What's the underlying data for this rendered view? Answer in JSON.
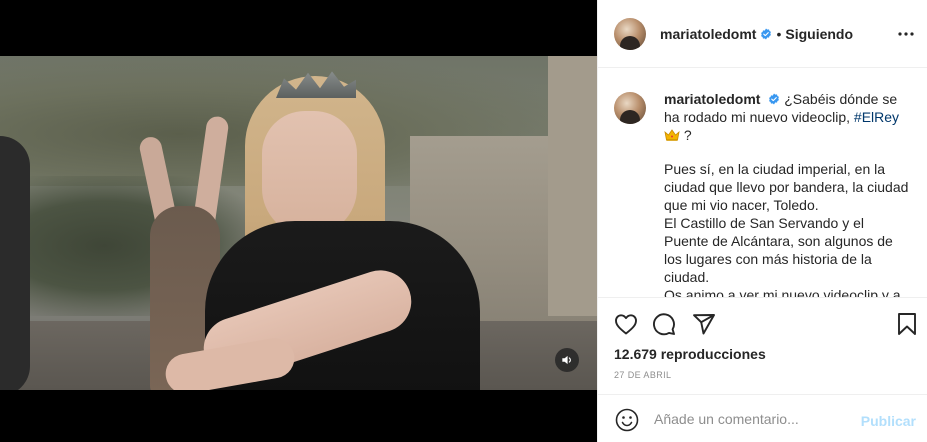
{
  "video": {
    "sound_icon": "speaker-icon"
  },
  "header": {
    "username": "mariatoledomt",
    "separator": "•",
    "follow_status": "Siguiendo",
    "more_icon": "more-options-icon",
    "verified_color": "#3897f0"
  },
  "caption": {
    "username": "mariatoledomt",
    "line1": "¿Sabéis dónde se ha rodado mi nuevo videoclip, ",
    "hashtag": "#ElRey",
    "emoji": "crown-emoji",
    "after_emoji": "?",
    "paragraph": [
      "Pues sí, en la ciudad imperial, en la ciudad que llevo por bandera, la ciudad que mi vio nacer, Toledo.",
      "El Castillo de San Servando y el Puente de Alcántara, son algunos de los lugares con más historia de la ciudad.",
      "Os animo a ver mi nuevo videoclip y a"
    ]
  },
  "actions": {
    "like_icon": "heart-icon",
    "comment_icon": "comment-icon",
    "share_icon": "share-icon",
    "save_icon": "bookmark-icon"
  },
  "stats": {
    "views": "12.679 reproducciones",
    "date": "27 DE ABRIL"
  },
  "comment_box": {
    "placeholder": "Añade un comentario...",
    "value": "",
    "publish_label": "Publicar",
    "publish_color": "#b2dffc"
  }
}
